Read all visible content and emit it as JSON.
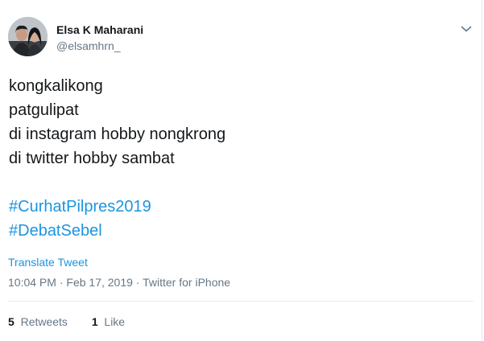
{
  "user": {
    "display_name": "Elsa K Maharani",
    "handle": "@elsamhrn_",
    "avatar_icon": "profile-photo-icon"
  },
  "menu": {
    "icon": "chevron-down-icon"
  },
  "tweet": {
    "lines": [
      "kongkalikong",
      "patgulipat",
      "di instagram hobby nongkrong",
      "di twitter hobby sambat"
    ],
    "hashtags": [
      "#CurhatPilpres2019",
      "#DebatSebel"
    ]
  },
  "translate_label": "Translate Tweet",
  "meta": {
    "time": "10:04 PM",
    "date": "Feb 17, 2019",
    "source": "Twitter for iPhone",
    "separator": " · "
  },
  "stats": {
    "retweets_count": "5",
    "retweets_label": "Retweets",
    "likes_count": "1",
    "likes_label": "Like"
  },
  "colors": {
    "link": "#1b95e0",
    "text": "#14171a",
    "muted": "#657786",
    "border": "#e6ecf0"
  }
}
